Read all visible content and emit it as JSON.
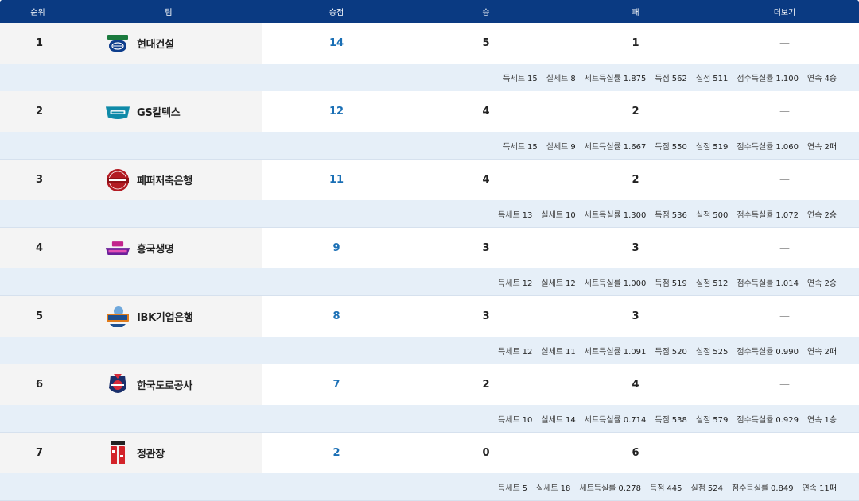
{
  "header": {
    "rank": "순위",
    "team": "팀",
    "points": "승점",
    "wins": "승",
    "losses": "패",
    "more": "더보기"
  },
  "detail_labels": {
    "sets_won": "득세트",
    "sets_lost": "실세트",
    "set_ratio": "세트득실률",
    "points_for": "득점",
    "points_against": "실점",
    "point_ratio": "점수득실률",
    "streak": "연속"
  },
  "teams": [
    {
      "rank": "1",
      "name": "현대건설",
      "logo": "hillstate-logo",
      "points": "14",
      "wins": "5",
      "losses": "1",
      "more": "—",
      "sets_won": "15",
      "sets_lost": "8",
      "set_ratio": "1.875",
      "points_for": "562",
      "points_against": "511",
      "point_ratio": "1.100",
      "streak": "4승"
    },
    {
      "rank": "2",
      "name": "GS칼텍스",
      "logo": "kixx-logo",
      "points": "12",
      "wins": "4",
      "losses": "2",
      "more": "—",
      "sets_won": "15",
      "sets_lost": "9",
      "set_ratio": "1.667",
      "points_for": "550",
      "points_against": "519",
      "point_ratio": "1.060",
      "streak": "2패"
    },
    {
      "rank": "3",
      "name": "페퍼저축은행",
      "logo": "peppers-logo",
      "points": "11",
      "wins": "4",
      "losses": "2",
      "more": "—",
      "sets_won": "13",
      "sets_lost": "10",
      "set_ratio": "1.300",
      "points_for": "536",
      "points_against": "500",
      "point_ratio": "1.072",
      "streak": "2승"
    },
    {
      "rank": "4",
      "name": "흥국생명",
      "logo": "pink-spiders-logo",
      "points": "9",
      "wins": "3",
      "losses": "3",
      "more": "—",
      "sets_won": "12",
      "sets_lost": "12",
      "set_ratio": "1.000",
      "points_for": "519",
      "points_against": "512",
      "point_ratio": "1.014",
      "streak": "2승"
    },
    {
      "rank": "5",
      "name": "IBK기업은행",
      "logo": "altos-logo",
      "points": "8",
      "wins": "3",
      "losses": "3",
      "more": "—",
      "sets_won": "12",
      "sets_lost": "11",
      "set_ratio": "1.091",
      "points_for": "520",
      "points_against": "525",
      "point_ratio": "0.990",
      "streak": "2패"
    },
    {
      "rank": "6",
      "name": "한국도로공사",
      "logo": "hi-pass-logo",
      "points": "7",
      "wins": "2",
      "losses": "4",
      "more": "—",
      "sets_won": "10",
      "sets_lost": "14",
      "set_ratio": "0.714",
      "points_for": "538",
      "points_against": "579",
      "point_ratio": "0.929",
      "streak": "1승"
    },
    {
      "rank": "7",
      "name": "정관장",
      "logo": "red-sparks-logo",
      "points": "2",
      "wins": "0",
      "losses": "6",
      "more": "—",
      "sets_won": "5",
      "sets_lost": "18",
      "set_ratio": "0.278",
      "points_for": "445",
      "points_against": "524",
      "point_ratio": "0.849",
      "streak": "11패"
    }
  ],
  "colors": {
    "header_bg": "#0a3a82",
    "detail_bg": "#e6eff8",
    "points_color": "#1a6fb5",
    "team_cell_bg": "#f4f4f4"
  }
}
